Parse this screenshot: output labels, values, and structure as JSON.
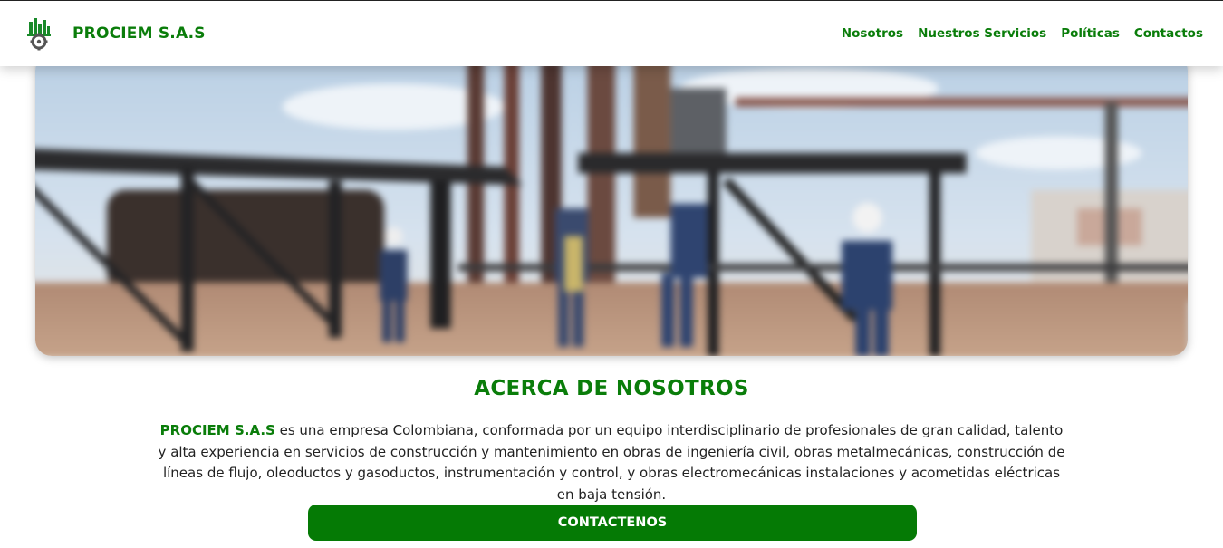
{
  "header": {
    "brand": "PROCIEM S.A.S",
    "logo_icon": "factory-gear-logo-icon",
    "nav": [
      "Nosotros",
      "Nuestros Servicios",
      "Políticas",
      "Contactos"
    ]
  },
  "hero": {
    "image": "industrial-construction-workers-photo"
  },
  "about": {
    "title": "ACERCA DE NOSOTROS",
    "company": "PROCIEM S.A.S",
    "text": " es una empresa Colombiana, conformada por un equipo interdisciplinario de profesionales de gran calidad, talento y alta experiencia en servicios de construcción y mantenimiento en obras de ingeniería civil, obras metalmecánicas, construcción de líneas de flujo, oleoductos y gasoductos, instrumentación y control, y obras electromecánicas instalaciones y acometidas eléctricas en baja tensión.",
    "cta": "CONTACTENOS"
  },
  "colors": {
    "brand_green": "#0a7d0a",
    "button_green": "#057a05"
  }
}
